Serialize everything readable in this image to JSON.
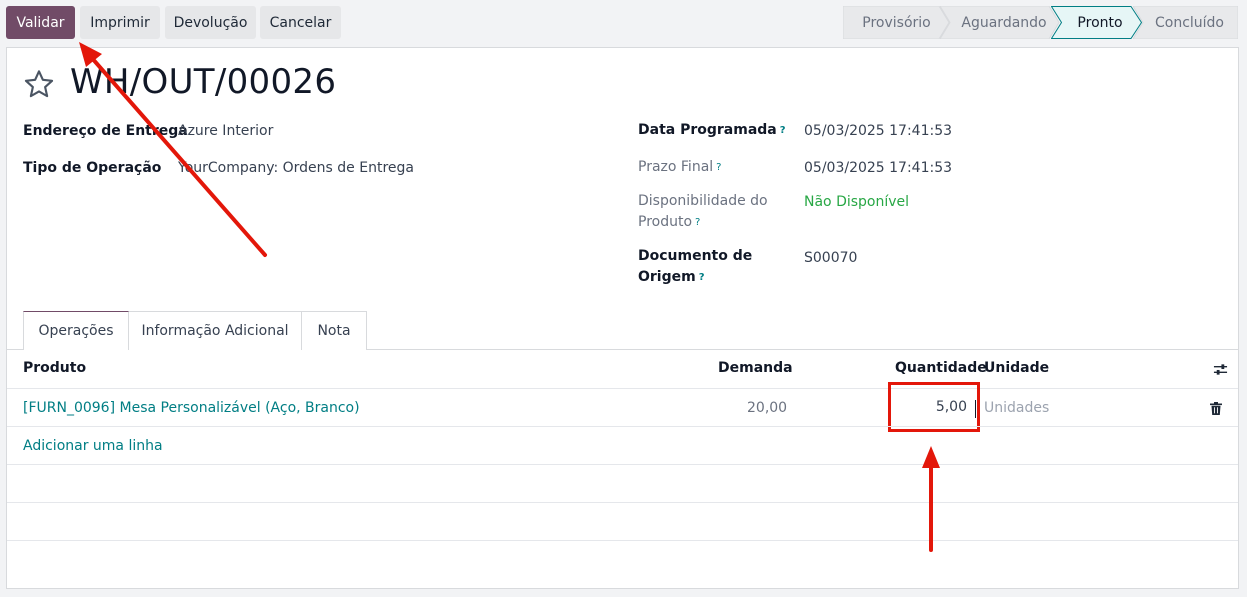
{
  "toolbar": {
    "validate_label": "Validar",
    "print_label": "Imprimir",
    "return_label": "Devolução",
    "cancel_label": "Cancelar"
  },
  "statusbar": {
    "stages": [
      "Provisório",
      "Aguardando",
      "Pronto",
      "Concluído"
    ],
    "active": "Pronto"
  },
  "record": {
    "title": "WH/OUT/00026",
    "fields": {
      "delivery_address_label": "Endereço de Entrega",
      "delivery_address_value": "Azure Interior",
      "operation_type_label": "Tipo de Operação",
      "operation_type_value": "YourCompany: Ordens de Entrega",
      "scheduled_date_label": "Data Programada",
      "scheduled_date_value": "05/03/2025 17:41:53",
      "deadline_label": "Prazo Final",
      "deadline_value": "05/03/2025 17:41:53",
      "availability_label_1": "Disponibilidade do",
      "availability_label_2": "Produto",
      "availability_value": "Não Disponível",
      "source_doc_label_1": "Documento de",
      "source_doc_label_2": "Origem",
      "source_doc_value": "S00070",
      "help_mark": "?"
    }
  },
  "tabs": [
    "Operações",
    "Informação Adicional",
    "Nota"
  ],
  "table": {
    "headers": {
      "product": "Produto",
      "demand": "Demanda",
      "quantity": "Quantidade",
      "unit": "Unidade"
    },
    "rows": [
      {
        "product": "[FURN_0096] Mesa Personalizável (Aço, Branco)",
        "demand": "20,00",
        "quantity": "5,00",
        "unit": "Unidades"
      }
    ],
    "add_line": "Adicionar uma linha"
  },
  "colors": {
    "primary": "#714b67",
    "link": "#017e84",
    "annotation": "#e3170a",
    "available_status": "#28a745"
  },
  "icons": [
    "star-icon",
    "settings-adjust-icon",
    "trash-icon",
    "help-icon"
  ]
}
